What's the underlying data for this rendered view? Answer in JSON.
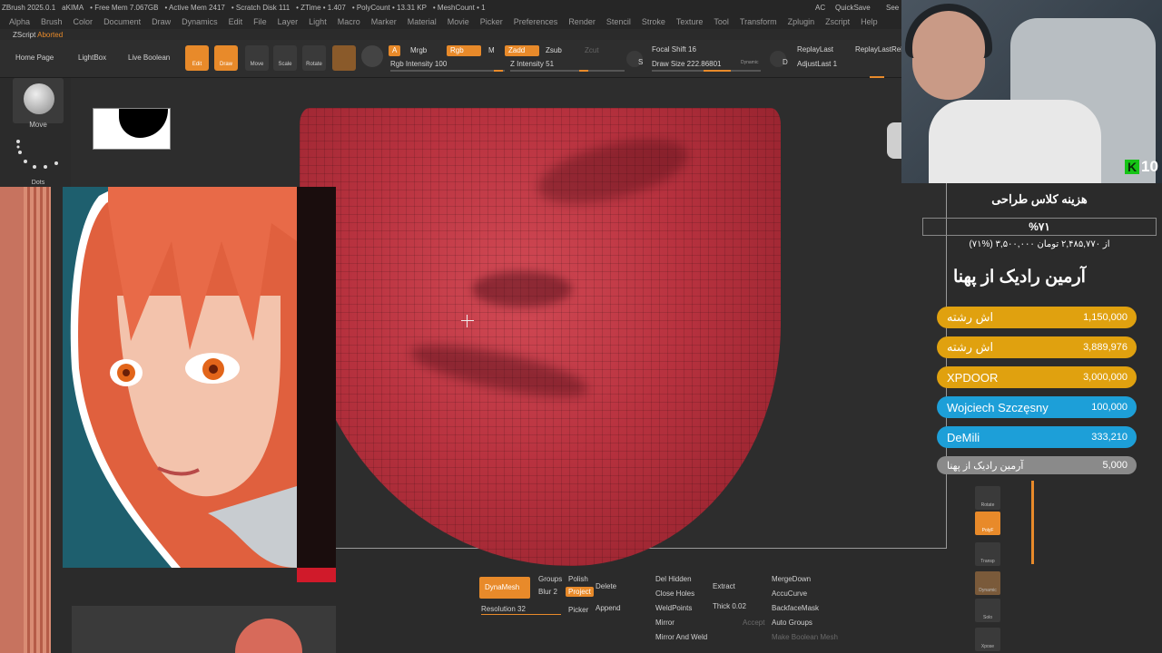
{
  "titlebar": {
    "app": "ZBrush 2025.0.1",
    "project": "aKIMA",
    "free_mem": "• Free Mem 7.067GB",
    "active_mem": "• Active Mem 2417",
    "scratch": "• Scratch Disk 111",
    "ztime": "• ZTime • 1.407",
    "polycount": "• PolyCount • 13.31 KP",
    "meshcount": "• MeshCount • 1",
    "ac": "AC",
    "quicksave": "QuickSave",
    "see": "See"
  },
  "menu": [
    "Alpha",
    "Brush",
    "Color",
    "Document",
    "Draw",
    "Dynamics",
    "Edit",
    "File",
    "Layer",
    "Light",
    "Macro",
    "Marker",
    "Material",
    "Movie",
    "Picker",
    "Preferences",
    "Render",
    "Stencil",
    "Stroke",
    "Texture",
    "Tool",
    "Transform",
    "Zplugin",
    "Zscript",
    "Help"
  ],
  "zscript": {
    "label": "ZScript",
    "status": "Aborted"
  },
  "toolbar": {
    "home": "Home Page",
    "lightbox": "LightBox",
    "live_boolean": "Live Boolean",
    "icons": {
      "edit": "Edit",
      "draw": "Draw",
      "move": "Move",
      "scale": "Scale",
      "rotate": "Rotate"
    },
    "a_label": "A",
    "mrgb": "Mrgb",
    "rgb": "Rgb",
    "m": "M",
    "zadd": "Zadd",
    "zsub": "Zsub",
    "zcut": "Zcut",
    "rgb_intensity": "Rgb Intensity 100",
    "z_intensity": "Z Intensity 51",
    "s": "S",
    "d": "D",
    "focal_shift": "Focal Shift 16",
    "draw_size": "Draw Size 222.86801",
    "dynamic": "Dynamic",
    "replay_last": "ReplayLast",
    "replay_last_rel": "ReplayLastRel",
    "adjust_last": "AdjustLast 1"
  },
  "leftpanel": {
    "brush": "Move",
    "stroke": "Dots"
  },
  "bottom": {
    "dynamesh": "DynaMesh",
    "groups": "Groups",
    "polish": "Polish",
    "blur": "Blur",
    "blur_value": "2",
    "project": "Project",
    "resolution": "Resolution 32",
    "delete": "Delete",
    "picker": "Picker",
    "append": "Append",
    "del_hidden": "Del Hidden",
    "close_holes": "Close Holes",
    "weldpoints": "WeldPoints",
    "mirror": "Mirror",
    "mirror_and_weld": "Mirror And Weld",
    "extract": "Extract",
    "thick": "Thick 0.02",
    "accept": "Accept",
    "merge_down": "MergeDown",
    "accucurve": "AccuCurve",
    "backface_mask": "BackfaceMask",
    "auto_groups": "Auto Groups",
    "make_boolean": "Make Boolean Mesh"
  },
  "overlay": {
    "title": "هزینه کلاس طراحی",
    "percent": "%۷۱",
    "summary": "(۷۱%) ۳,۵۰۰,۰۰۰ از ۲,۴۸۵,۷۷۰ تومان",
    "top_name": "آرمین رادیک از پهنا",
    "webcam_count": "10",
    "donors": [
      {
        "name": "اش رشته",
        "amount": "1,150,000",
        "color": "#e0a10f"
      },
      {
        "name": "اش رشته",
        "amount": "3,889,976",
        "color": "#e0a10f"
      },
      {
        "name": "XPDOOR",
        "amount": "3,000,000",
        "color": "#e0a10f"
      },
      {
        "name": "Wojciech Szczęsny",
        "amount": "100,000",
        "color": "#1d9fd8"
      },
      {
        "name": "DeMili",
        "amount": "333,210",
        "color": "#1d9fd8"
      },
      {
        "name": "آرمین رادیک از پهنا",
        "amount": "5,000",
        "color": "#8a8a8a"
      }
    ]
  },
  "rightpanel": {
    "rotate": "Rotate",
    "polyf": "PolyF",
    "transp": "Transp",
    "dynamic": "Dynamic",
    "solo": "Solo",
    "xpose": "Xpose"
  },
  "colors": {
    "accent": "#e88a2a",
    "mesh": "#c23c48"
  }
}
